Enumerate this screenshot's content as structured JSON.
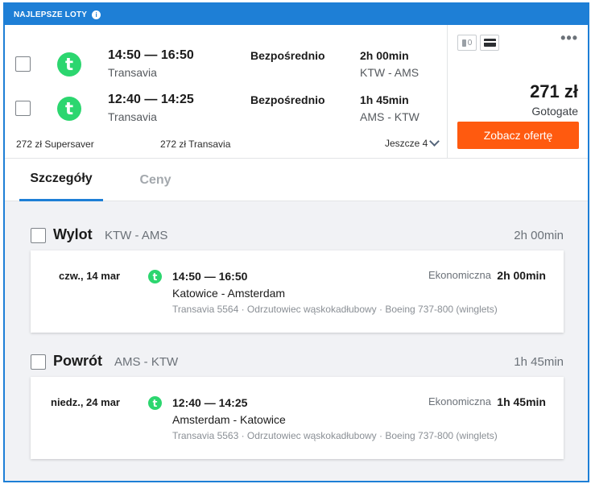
{
  "badge": {
    "label": "NAJLEPSZE LOTY",
    "icon": "info-icon"
  },
  "legs": [
    {
      "times": "14:50 — 16:50",
      "carrier": "Transavia",
      "stops": "Bezpośrednio",
      "duration": "2h 00min",
      "route": "KTW - AMS"
    },
    {
      "times": "12:40 — 14:25",
      "carrier": "Transavia",
      "stops": "Bezpośrednio",
      "duration": "1h 45min",
      "route": "AMS - KTW"
    }
  ],
  "alt_prices": [
    "272 zł Supersaver",
    "272 zł Transavia"
  ],
  "more_label": "Jeszcze 4",
  "bags": {
    "carry_on_count": "0"
  },
  "offer": {
    "price": "271 zł",
    "provider": "Gotogate",
    "button": "Zobacz ofertę"
  },
  "tabs": {
    "details": "Szczegóły",
    "prices": "Ceny"
  },
  "sections": [
    {
      "title": "Wylot",
      "route": "KTW - AMS",
      "duration": "2h 00min",
      "date": "czw., 14 mar",
      "times": "14:50 — 16:50",
      "cities": "Katowice - Amsterdam",
      "info": "Transavia 5564 · Odrzutowiec wąskokadłubowy · Boeing 737-800 (winglets)",
      "cabin": "Ekonomiczna",
      "seg_duration": "2h 00min"
    },
    {
      "title": "Powrót",
      "route": "AMS - KTW",
      "duration": "1h 45min",
      "date": "niedz., 24 mar",
      "times": "12:40 — 14:25",
      "cities": "Amsterdam - Katowice",
      "info": "Transavia 5563 · Odrzutowiec wąskokadłubowy · Boeing 737-800 (winglets)",
      "cabin": "Ekonomiczna",
      "seg_duration": "1h 45min"
    }
  ],
  "colors": {
    "accent": "#1e7fd6",
    "cta": "#ff5a0f",
    "airline": "#2cd66f"
  }
}
